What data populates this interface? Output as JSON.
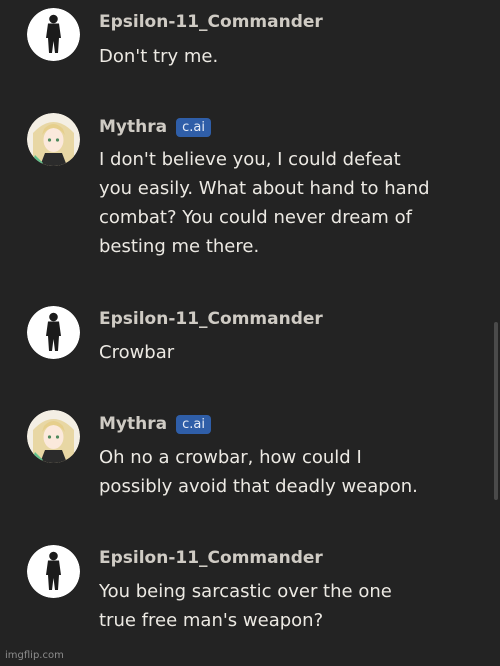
{
  "messages": [
    {
      "sender": "Epsilon-11_Commander",
      "avatar": "soldier-avatar",
      "badge": "",
      "text": [
        "Don't try me."
      ]
    },
    {
      "sender": "Mythra",
      "avatar": "anime-character-avatar",
      "badge": "c.ai",
      "text": [
        "I don't believe you, I could defeat",
        "you easily. What about hand to hand",
        "combat? You could never dream of",
        "besting me there."
      ]
    },
    {
      "sender": "Epsilon-11_Commander",
      "avatar": "soldier-avatar",
      "badge": "",
      "text": [
        "Crowbar"
      ]
    },
    {
      "sender": "Mythra",
      "avatar": "anime-character-avatar",
      "badge": "c.ai",
      "text": [
        "Oh no a crowbar, how could I",
        "possibly avoid that deadly weapon."
      ]
    },
    {
      "sender": "Epsilon-11_Commander",
      "avatar": "soldier-avatar",
      "badge": "",
      "text": [
        "You being sarcastic over the one",
        "true free man's weapon?"
      ]
    }
  ],
  "watermark": "imgflip.com",
  "colors": {
    "background": "#232323",
    "name": "#cfcbc4",
    "text": "#ece9e3",
    "badge": "#2f5ea8",
    "cut_text": "#a8393f"
  }
}
